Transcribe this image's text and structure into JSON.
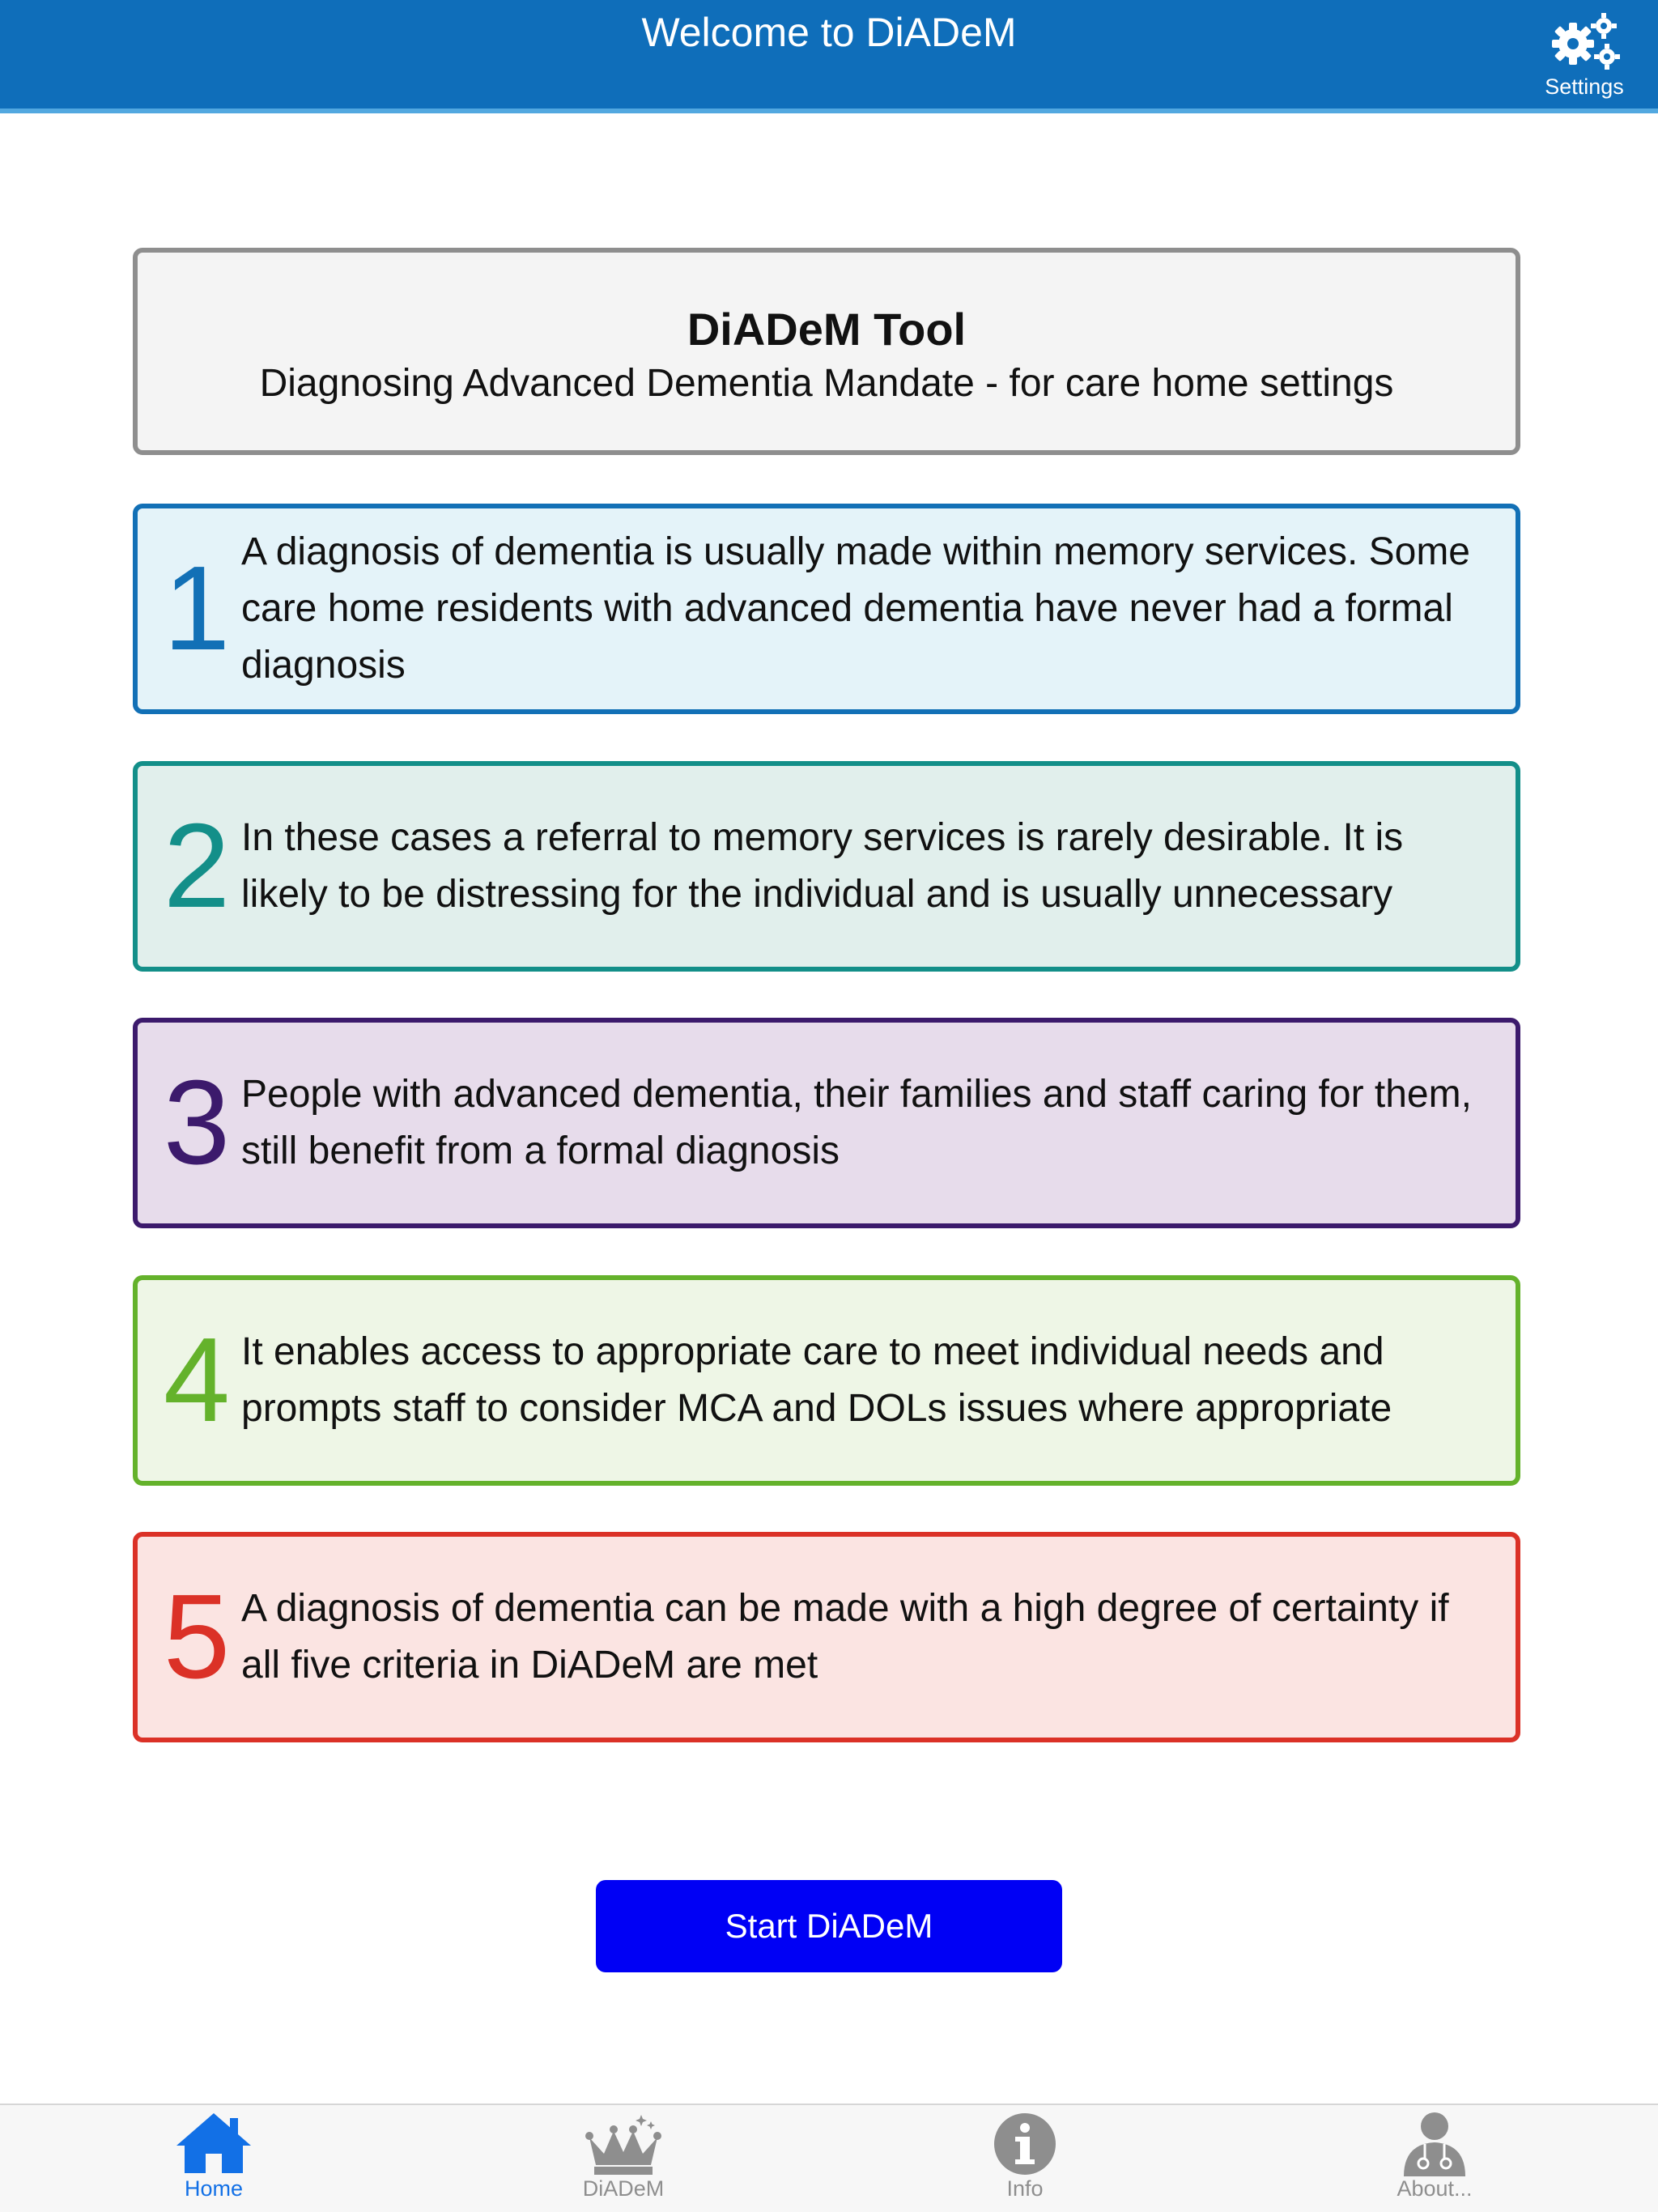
{
  "navbar": {
    "title": "Welcome to DiADeM",
    "settings_label": "Settings",
    "settings_icon": "gears-icon",
    "background_color": "#0f6eba"
  },
  "header": {
    "title": "DiADeM Tool",
    "subtitle": "Diagnosing Advanced Dementia Mandate - for care home settings"
  },
  "cards": [
    {
      "number": "1",
      "text": "A diagnosis of dementia is usually made within memory services. Some care home residents with advanced dementia have never had a formal diagnosis",
      "color": "#1270b6"
    },
    {
      "number": "2",
      "text": "In these cases a referral to memory services is rarely desirable. It is likely to be distressing for the individual and is usually unnecessary",
      "color": "#138f89"
    },
    {
      "number": "3",
      "text": "People with advanced dementia, their families and staff caring for them, still benefit from a formal diagnosis",
      "color": "#3c1a6c"
    },
    {
      "number": "4",
      "text": "It enables access to appropriate care to meet individual needs and prompts staff to consider MCA and DOLs issues where appropriate",
      "color": "#64b22b"
    },
    {
      "number": "5",
      "text": "A diagnosis of dementia can be made with a high degree of certainty if all five criteria in DiADeM are met",
      "color": "#db3127"
    }
  ],
  "start_button": {
    "label": "Start DiADeM",
    "color": "#0000f5"
  },
  "tabbar": {
    "tabs": [
      {
        "label": "Home",
        "icon": "home-icon",
        "active": true
      },
      {
        "label": "DiADeM",
        "icon": "crown-icon",
        "active": false
      },
      {
        "label": "Info",
        "icon": "info-icon",
        "active": false
      },
      {
        "label": "About...",
        "icon": "doctor-icon",
        "active": false
      }
    ],
    "active_color": "#1270e6",
    "inactive_color": "#8e8e8e"
  }
}
